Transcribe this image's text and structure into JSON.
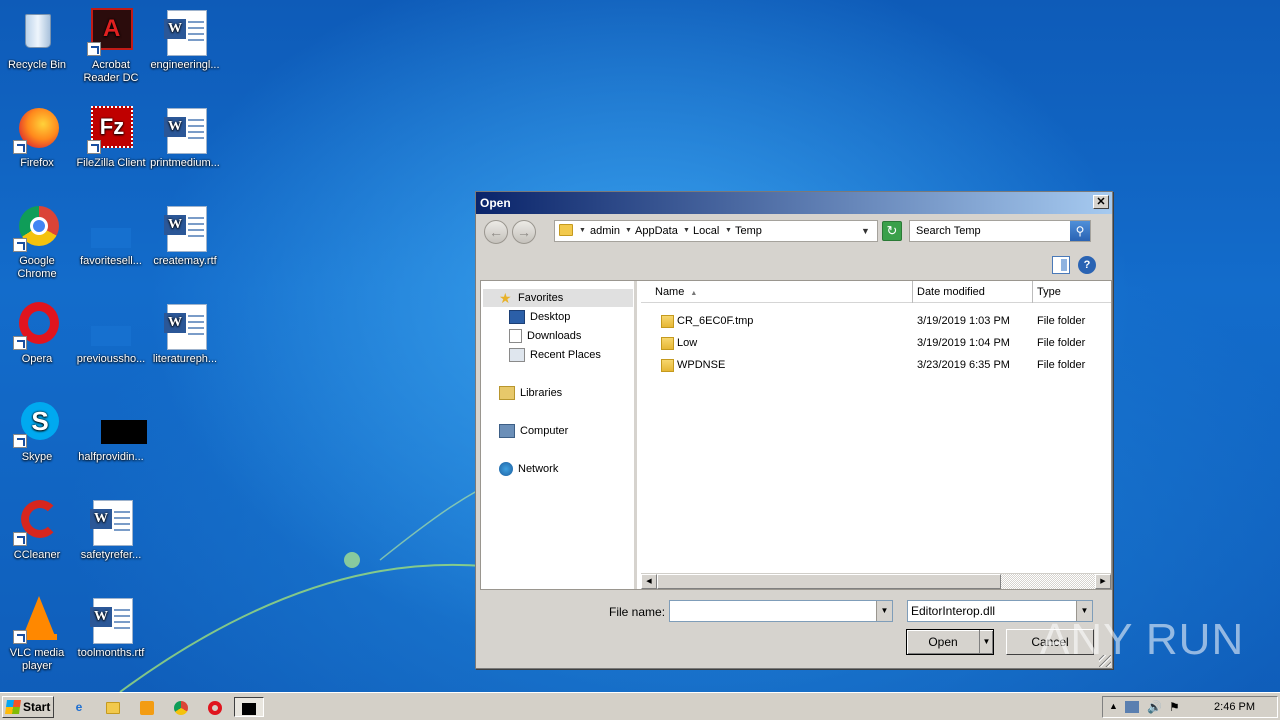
{
  "desktop": {
    "icons": [
      {
        "label": "Recycle Bin"
      },
      {
        "label": "Acrobat Reader DC"
      },
      {
        "label": "engineeringl..."
      },
      {
        "label": "Firefox"
      },
      {
        "label": "FileZilla Client"
      },
      {
        "label": "printmedium..."
      },
      {
        "label": "Google Chrome"
      },
      {
        "label": "favoritesell..."
      },
      {
        "label": "createmay.rtf"
      },
      {
        "label": "Opera"
      },
      {
        "label": "previoussho..."
      },
      {
        "label": "literatureph..."
      },
      {
        "label": "Skype"
      },
      {
        "label": "halfprovidin..."
      },
      {
        "label": "CCleaner"
      },
      {
        "label": "safetyrefer..."
      },
      {
        "label": "VLC media player"
      },
      {
        "label": "toolmonths.rtf"
      }
    ]
  },
  "dialog": {
    "title": "Open",
    "close_glyph": "✕",
    "breadcrumb": [
      "admin",
      "AppData",
      "Local",
      "Temp"
    ],
    "search_placeholder": "Search Temp",
    "nav": {
      "favorites": "Favorites",
      "desktop": "Desktop",
      "downloads": "Downloads",
      "recent": "Recent Places",
      "libraries": "Libraries",
      "computer": "Computer",
      "network": "Network"
    },
    "columns": {
      "name": "Name",
      "date": "Date modified",
      "type": "Type"
    },
    "files": [
      {
        "name": "CR_6EC0F.tmp",
        "date": "3/19/2019 1:03 PM",
        "type": "File folder"
      },
      {
        "name": "Low",
        "date": "3/19/2019 1:04 PM",
        "type": "File folder"
      },
      {
        "name": "WPDNSE",
        "date": "3/23/2019 6:35 PM",
        "type": "File folder"
      }
    ],
    "file_name_label": "File name:",
    "file_name_value": "",
    "filter_value": "EditorInterop.dll",
    "open_label": "Open",
    "cancel_label": "Cancel"
  },
  "watermark": "ANY RUN",
  "taskbar": {
    "start_label": "Start",
    "clock": "2:46 PM"
  },
  "colors": {
    "titlebar_start": "#0a246a",
    "titlebar_end": "#a6caf0",
    "desktop_blue": "#136ccb"
  }
}
